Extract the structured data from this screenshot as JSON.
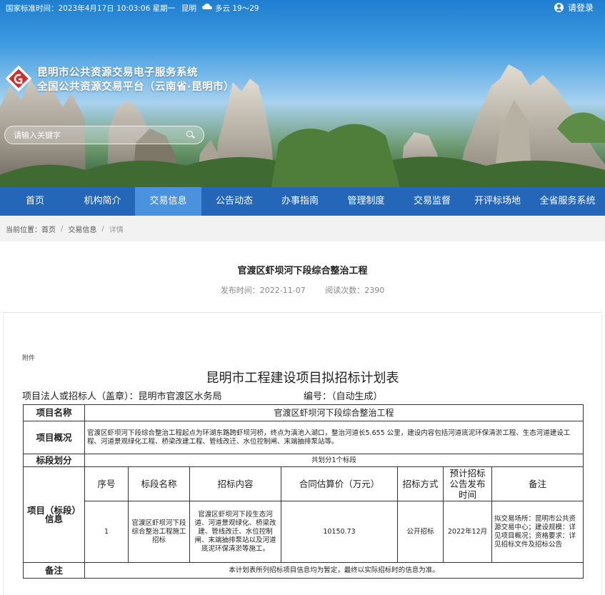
{
  "topbar": {
    "time": "国家标准时间：2023年4月17日 10:03:06 星期一",
    "city": "昆明",
    "weather_icon": "cloud-icon",
    "weather": "多云 19～29",
    "login_label": "请登录",
    "login_icon": "user-icon"
  },
  "site": {
    "title_line1": "昆明市公共资源交易电子服务系统",
    "title_line2": "全国公共资源交易平台（云南省·昆明市）",
    "logo_icon": "platform-logo"
  },
  "search": {
    "placeholder": "请输入关键字",
    "icon": "search-icon"
  },
  "nav": {
    "items": [
      {
        "label": "首页"
      },
      {
        "label": "机构简介"
      },
      {
        "label": "交易信息"
      },
      {
        "label": "公告动态"
      },
      {
        "label": "办事指南"
      },
      {
        "label": "管理制度"
      },
      {
        "label": "交易监督"
      },
      {
        "label": "开评标场地"
      },
      {
        "label": "全省服务系统"
      }
    ],
    "active_index": 2,
    "bg_color": "#2466b8",
    "active_color": "#4a91de"
  },
  "breadcrumb": {
    "prefix": "当前位置：",
    "items": [
      "首页",
      "交易信息",
      "详情"
    ]
  },
  "article": {
    "title": "官渡区虾坝河下段综合整治工程",
    "publish_time": "发布时间：2022-11-07",
    "read_count": "阅读次数：2390"
  },
  "document": {
    "attachment_label": "附件",
    "title": "昆明市工程建设项目拟招标计划表",
    "owner": "项目法人或招标人（盖章）：昆明市官渡区水务局",
    "code": "编号：（自动生成）",
    "table": {
      "project_name_label": "项目名称",
      "project_name": "官渡区虾坝河下段综合整治工程",
      "overview_label": "项目概况",
      "overview": "官渡区虾坝河下段综合整治工程起点为环湖东路跨虾坝河桥，终点为滇池入湖口，整治河道长5.655 公里，建设内容包括河道底泥环保清淤工程、生态河道建设工程、河道景观绿化工程、桥梁改建工程、管线改迁、水位控制闸、末端抽排泵站等。",
      "section_label": "标段划分",
      "section_value": "共划分1个标段",
      "info_label": "项目（标段）信息",
      "columns": [
        "序号",
        "标段名称",
        "招标内容",
        "合同估算价（万元）",
        "招标方式",
        "预计招标公告发布时间",
        "备注"
      ],
      "rows": [
        {
          "no": "1",
          "name": "官渡区虾坝河下段综合整治工程施工招标",
          "content": "官渡区虾坝河下段生态河道、河道景观绿化、桥梁改建、管线改迁、水位控制闸、末端抽排泵站以及河道底泥环保清淤等施工。",
          "price": "10150.73",
          "method": "公开招标",
          "date": "2022年12月",
          "remark": "拟交易场所：昆明市公共资源交易中心；建设规模：详见项目概况；资格要求：详见招标文件及招标公告"
        }
      ],
      "remark_label": "备注",
      "remark_text": "本计划表所列招标项目信息均为暂定，最终以实际招标时的信息为准。"
    }
  }
}
